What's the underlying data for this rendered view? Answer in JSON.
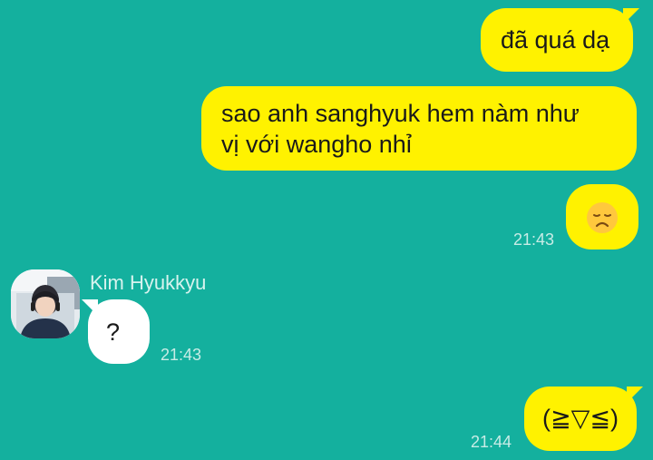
{
  "messages": [
    {
      "id": "m1",
      "text": "đã quá dạ"
    },
    {
      "id": "m2",
      "line1": "sao anh sanghyuk hem nàm như",
      "line2": "vị với wangho nhỉ"
    },
    {
      "id": "m3",
      "emoji": "disappointed-face",
      "time": "21:43"
    },
    {
      "id": "m4",
      "sender": "Kim Hyukkyu",
      "text": "?",
      "time": "21:43"
    },
    {
      "id": "m5",
      "text": "(≧▽≦)",
      "time": "21:44"
    }
  ],
  "colors": {
    "background": "#14b09e",
    "outgoing_bubble": "#fff200",
    "incoming_bubble": "#ffffff",
    "timestamp": "#c8ece6"
  }
}
